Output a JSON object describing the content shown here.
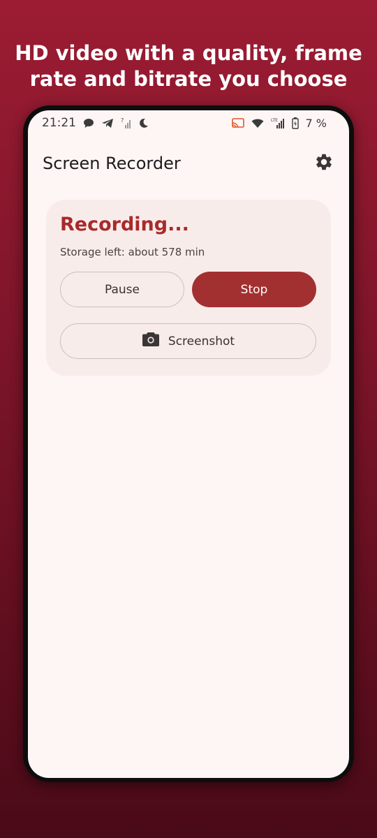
{
  "promo": {
    "line1": "HD video with a quality, frame",
    "line2": "rate and bitrate you choose"
  },
  "status_bar": {
    "time": "21:21",
    "battery_text": "7 %",
    "left_icons": [
      "chat-bubble-icon",
      "telegram-icon",
      "no-signal-icon",
      "moon-icon"
    ],
    "right_icons": [
      "cast-icon",
      "wifi-icon",
      "lte-signal-icon",
      "battery-icon"
    ]
  },
  "app_bar": {
    "title": "Screen Recorder",
    "settings_icon": "gear-icon"
  },
  "recording_card": {
    "title": "Recording...",
    "storage": "Storage left: about 578 min",
    "pause_label": "Pause",
    "stop_label": "Stop",
    "screenshot_label": "Screenshot",
    "screenshot_icon": "camera-icon"
  },
  "colors": {
    "background_top": "#9c1c33",
    "background_bottom": "#4a0a17",
    "accent": "#a33030",
    "card_bg": "#f8eceb",
    "screen_bg": "#fdf6f5"
  }
}
